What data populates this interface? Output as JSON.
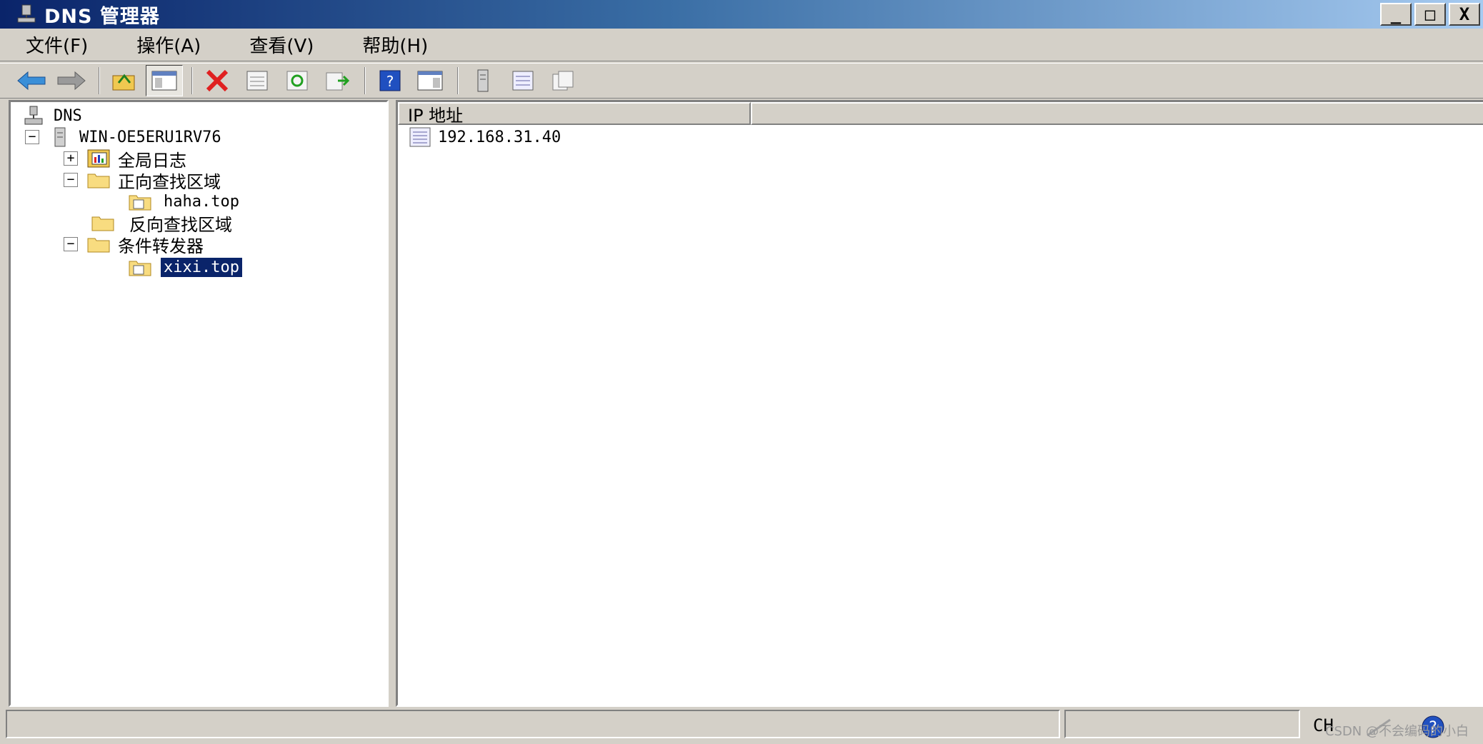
{
  "window": {
    "title": "DNS 管理器",
    "controls": [
      "_",
      "□",
      "X"
    ]
  },
  "menu": [
    "文件(F)",
    "操作(A)",
    "查看(V)",
    "帮助(H)"
  ],
  "toolbar": {
    "icons": [
      "back-arrow-icon",
      "forward-arrow-icon",
      "up-folder-icon",
      "show-hide-tree-icon",
      "delete-icon",
      "properties-icon",
      "refresh-icon",
      "export-list-icon",
      "help-icon",
      "console-icon",
      "server-icon",
      "list-view-icon",
      "copy-icon"
    ]
  },
  "tree": {
    "root": "DNS",
    "server": "WIN-OE5ERU1RV76",
    "nodes": [
      {
        "label": "全局日志",
        "expander": "+"
      },
      {
        "label": "正向查找区域",
        "expander": "−"
      },
      {
        "label": "haha.top",
        "expander": ""
      },
      {
        "label": "反向查找区域",
        "expander": ""
      },
      {
        "label": "条件转发器",
        "expander": "−"
      },
      {
        "label": "xixi.top",
        "expander": ""
      }
    ]
  },
  "list": {
    "column": "IP 地址",
    "rows": [
      "192.168.31.40"
    ]
  },
  "status": {
    "lang": "CH",
    "watermark": "CSDN @不会编码的小白"
  }
}
